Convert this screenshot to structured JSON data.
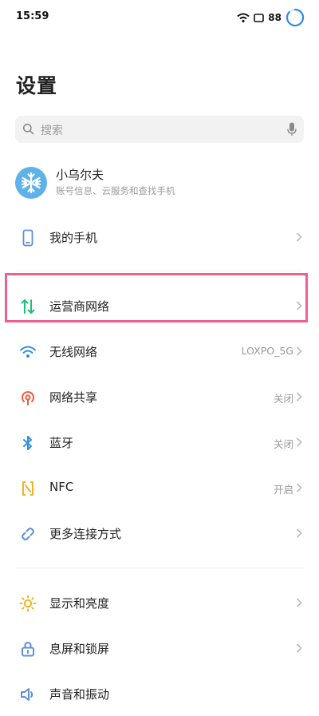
{
  "status_bar": {
    "time": "15:59",
    "battery": "88"
  },
  "page": {
    "title": "设置"
  },
  "search": {
    "placeholder": "搜索"
  },
  "account": {
    "name": "小乌尔夫",
    "subtitle": "账号信息、云服务和查找手机"
  },
  "items": [
    {
      "label": "我的手机",
      "value": "",
      "icon": "phone-icon"
    },
    {
      "label": "运营商网络",
      "value": "",
      "icon": "mobile-data-icon"
    },
    {
      "label": "无线网络",
      "value": "LOXPO_5G",
      "icon": "wifi-icon"
    },
    {
      "label": "网络共享",
      "value": "关闭",
      "icon": "hotspot-icon"
    },
    {
      "label": "蓝牙",
      "value": "关闭",
      "icon": "bluetooth-icon"
    },
    {
      "label": "NFC",
      "value": "开启",
      "icon": "nfc-icon"
    },
    {
      "label": "更多连接方式",
      "value": "",
      "icon": "link-icon"
    },
    {
      "label": "显示和亮度",
      "value": "",
      "icon": "brightness-icon"
    },
    {
      "label": "息屏和锁屏",
      "value": "",
      "icon": "lock-icon"
    },
    {
      "label": "声音和振动",
      "value": "",
      "icon": "sound-icon"
    }
  ],
  "colors": {
    "highlight": "#ef5f92",
    "mobile_data": "#1fbf7a",
    "wifi": "#2f8de4",
    "hotspot": "#f0593f",
    "bluetooth": "#2f8de4",
    "nfc": "#f2b320",
    "link": "#5b8fd6",
    "brightness": "#f2b320",
    "avatar": "#5fb1ea"
  }
}
